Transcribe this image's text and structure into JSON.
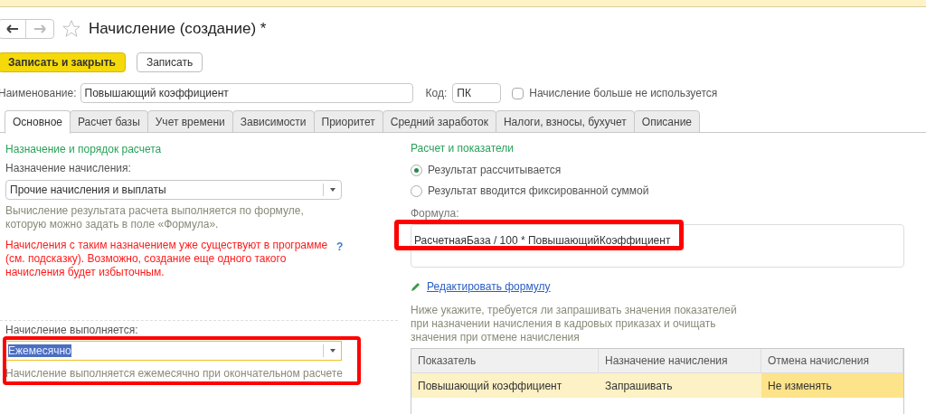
{
  "nav": {
    "back_enabled": true,
    "forward_enabled": false
  },
  "window": {
    "title": "Начисление (создание) *",
    "favorite": false
  },
  "toolbar": {
    "buttons": [
      {
        "label": "Записать и закрыть",
        "kind": "primary"
      },
      {
        "label": "Записать",
        "kind": "default"
      }
    ]
  },
  "header": {
    "name_label": "Наименование:",
    "name_value": "Повышающий коэффициент",
    "code_label": "Код:",
    "code_value": "ПК",
    "unused_label": "Начисление больше не используется",
    "unused_checked": false
  },
  "tabs": [
    {
      "label": "Основное",
      "selected": true
    },
    {
      "label": "Расчет базы",
      "selected": false
    },
    {
      "label": "Учет времени",
      "selected": false
    },
    {
      "label": "Зависимости",
      "selected": false
    },
    {
      "label": "Приоритет",
      "selected": false
    },
    {
      "label": "Средний заработок",
      "selected": false
    },
    {
      "label": "Налоги, взносы, бухучет",
      "selected": false
    },
    {
      "label": "Описание",
      "selected": false
    }
  ],
  "left": {
    "section_title": "Назначение и порядок расчета",
    "purpose_label": "Назначение начисления:",
    "purpose_value": "Прочие начисления и выплаты",
    "purpose_hint": "Вычисление результата расчета выполняется по формуле, которую можно задать в поле «Формула».",
    "warning": "Начисления с таким назначением уже существуют в программе (см. подсказку). Возможно, создание еще одного такого начисления будет избыточным.",
    "help": "?",
    "period_label": "Начисление выполняется:",
    "period_value": "Ежемесячно",
    "period_value_selected": true,
    "period_highlighted": true,
    "period_hint": "Начисление выполняется ежемесячно при окончательном расчете"
  },
  "right": {
    "section_title": "Расчет и показатели",
    "radios": [
      {
        "label": "Результат рассчитывается",
        "selected": true
      },
      {
        "label": "Результат вводится фиксированной суммой",
        "selected": false
      }
    ],
    "formula_label": "Формула:",
    "formula_value": "РасчетнаяБаза / 100 * ПовышающийКоэффициент",
    "formula_highlighted": true,
    "edit_link": "Редактировать формулу",
    "table_hint": "Ниже укажите, требуется ли запрашивать значения показателей при назначении начисления в кадровых приказах и очищать значения при отмене начисления",
    "table": {
      "columns": [
        "Показатель",
        "Назначение начисления",
        "Отмена начисления"
      ],
      "rows": [
        {
          "selected": true,
          "cells": [
            {
              "text": "Повышающий коэффициент",
              "current": false
            },
            {
              "text": "Запрашивать",
              "current": false
            },
            {
              "text": "Не изменять",
              "current": true
            }
          ]
        }
      ]
    }
  }
}
